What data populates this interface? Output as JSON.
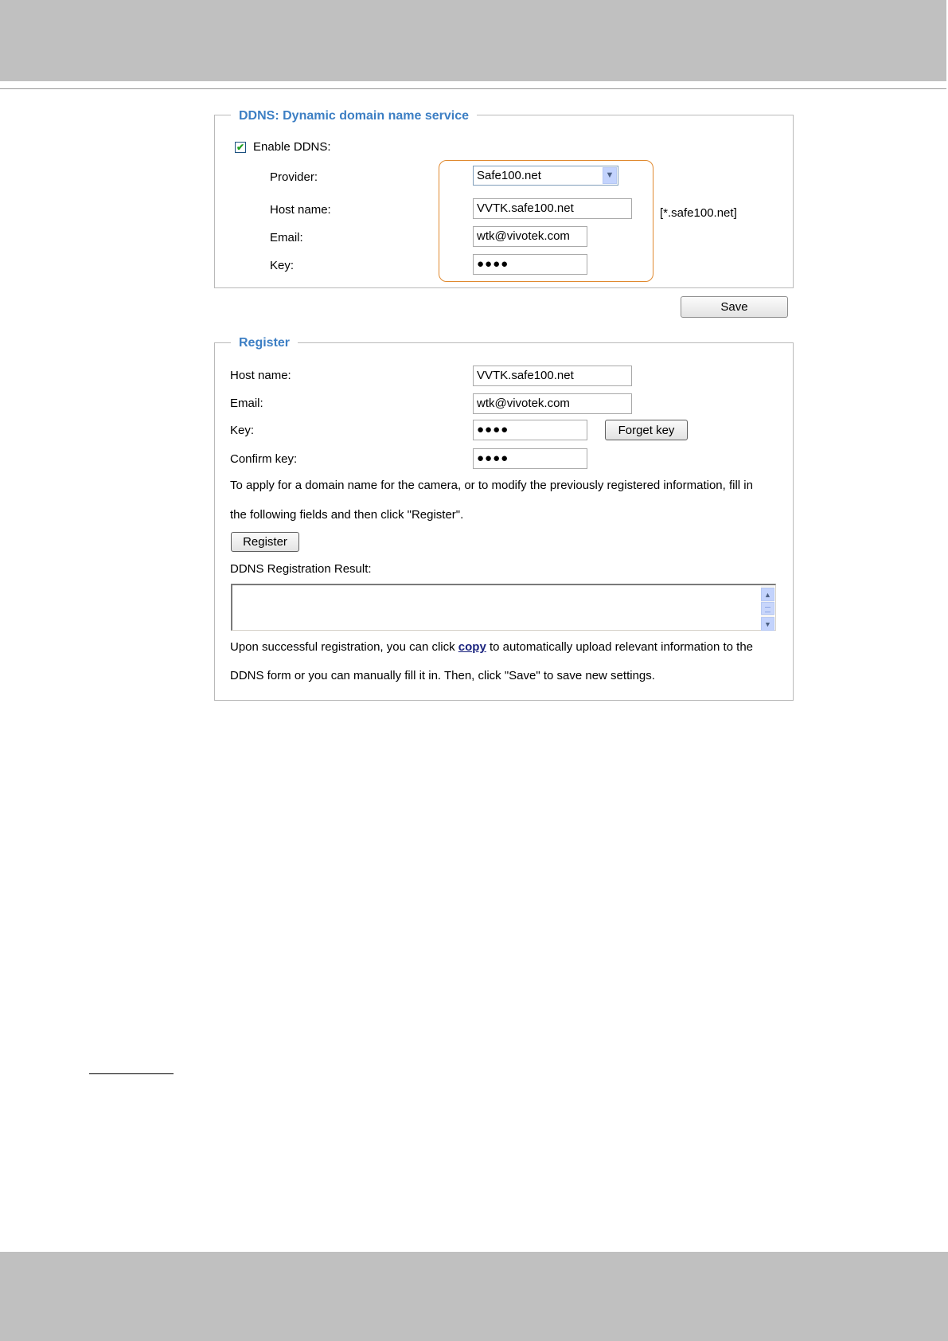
{
  "ddns": {
    "legend": "DDNS: Dynamic domain name service",
    "enable_label": "Enable DDNS:",
    "enable_checked": true,
    "provider_label": "Provider:",
    "provider_value": "Safe100.net",
    "host_label": "Host name:",
    "host_value": "VVTK.safe100.net",
    "host_suffix": "[*.safe100.net]",
    "email_label": "Email:",
    "email_value": "wtk@vivotek.com",
    "key_label": "Key:",
    "key_value": "●●●●",
    "highlight_color": "#e0892f"
  },
  "save_label": "Save",
  "register": {
    "legend": "Register",
    "host_label": "Host name:",
    "host_value": "VVTK.safe100.net",
    "email_label": "Email:",
    "email_value": "wtk@vivotek.com",
    "key_label": "Key:",
    "key_value": "●●●●",
    "forget_key_label": "Forget key",
    "confirm_label": "Confirm key:",
    "confirm_value": "●●●●",
    "instructions_line1": "To apply for a domain name for the camera, or to modify the previously registered information, fill in",
    "instructions_line2": "the following fields and then click \"Register\".",
    "register_button": "Register",
    "result_label": "DDNS Registration Result:",
    "note_before_link": "Upon successful registration, you can click ",
    "copy_link": "copy",
    "note_after_link": " to automatically upload relevant information to the",
    "note_line2": "DDNS form or you can manually fill it in. Then, click \"Save\" to save new settings."
  },
  "colors": {
    "legend": "#3d7fc4",
    "page_band": "#c0c0c0",
    "link": "#1a237e",
    "checkmark": "#21a121"
  },
  "icons": {
    "dropdown": "chevron-down-icon",
    "checkbox": "checkmark-icon",
    "scroll_up": "arrow-up-icon",
    "scroll_down": "arrow-down-icon"
  }
}
